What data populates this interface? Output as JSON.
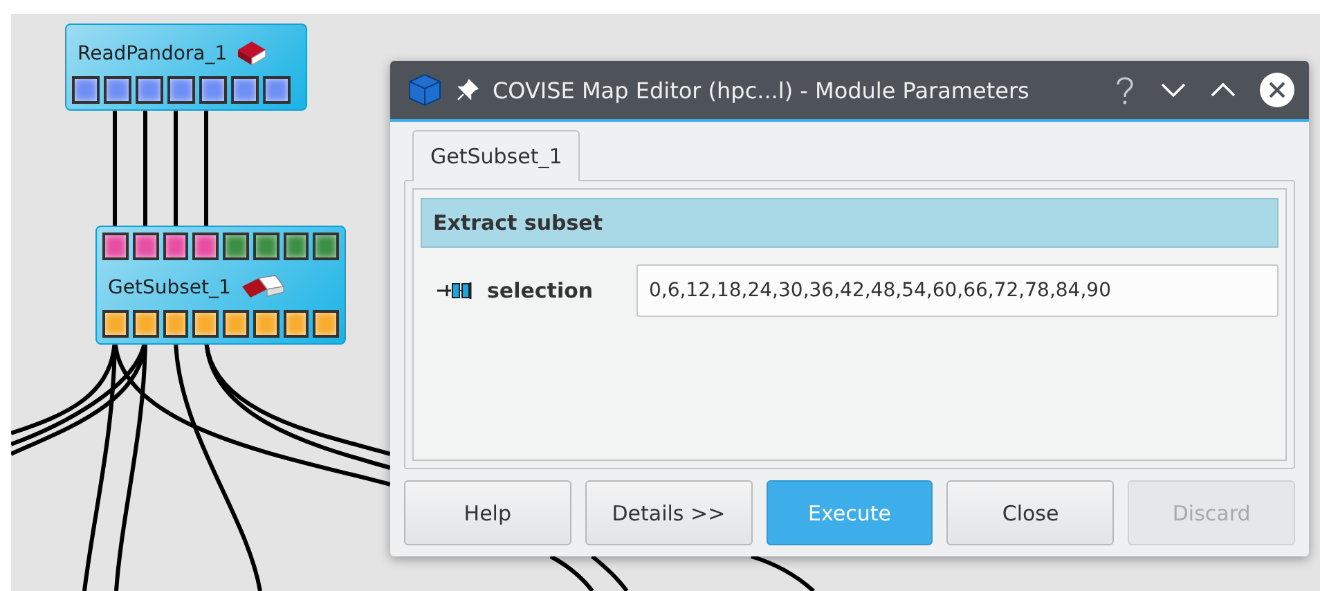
{
  "canvas": {
    "modules": [
      {
        "name": "ReadPandora_1",
        "kind": "source",
        "outputs": [
          {
            "color": "#6f8ff5"
          },
          {
            "color": "#6f8ff5"
          },
          {
            "color": "#6f8ff5"
          },
          {
            "color": "#6f8ff5"
          },
          {
            "color": "#6f8ff5"
          },
          {
            "color": "#6f8ff5"
          },
          {
            "color": "#6f8ff5"
          }
        ]
      },
      {
        "name": "GetSubset_1",
        "kind": "filter",
        "inputs": [
          {
            "color": "#e64fa5"
          },
          {
            "color": "#e64fa5"
          },
          {
            "color": "#e64fa5"
          },
          {
            "color": "#e64fa5"
          },
          {
            "color": "#3d8f45"
          },
          {
            "color": "#3d8f45"
          },
          {
            "color": "#3d8f45"
          },
          {
            "color": "#3d8f45"
          }
        ],
        "outputs": [
          {
            "color": "#f7ac2e"
          },
          {
            "color": "#f7ac2e"
          },
          {
            "color": "#f7ac2e"
          },
          {
            "color": "#f7ac2e"
          },
          {
            "color": "#f7ac2e"
          },
          {
            "color": "#f7ac2e"
          },
          {
            "color": "#f7ac2e"
          },
          {
            "color": "#f7ac2e"
          }
        ]
      }
    ]
  },
  "dialog": {
    "title": "COVISE Map Editor (hpc...l) - Module Parameters",
    "tabs": [
      {
        "label": "GetSubset_1",
        "selected": true
      }
    ],
    "group": {
      "title": "Extract subset",
      "params": [
        {
          "label": "selection",
          "value": "0,6,12,18,24,30,36,42,48,54,60,66,72,78,84,90"
        }
      ]
    },
    "buttons": [
      {
        "label": "Help",
        "primary": false,
        "disabled": false
      },
      {
        "label": "Details >>",
        "primary": false,
        "disabled": false
      },
      {
        "label": "Execute",
        "primary": true,
        "disabled": false
      },
      {
        "label": "Close",
        "primary": false,
        "disabled": false
      },
      {
        "label": "Discard",
        "primary": false,
        "disabled": true
      }
    ]
  }
}
